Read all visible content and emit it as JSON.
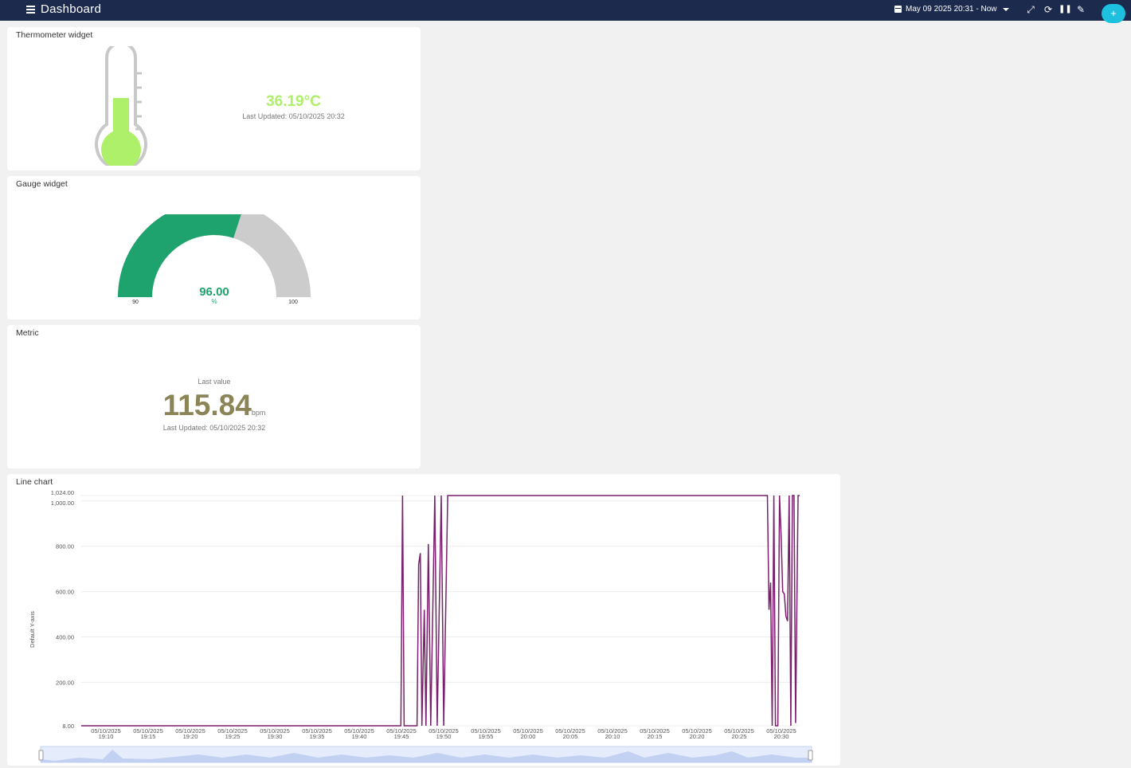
{
  "app": {
    "title": "Dashboard",
    "date_range": "May 09 2025 20:31 - Now",
    "add_label": "+"
  },
  "thermometer": {
    "title": "Thermometer widget",
    "value": "36.19°C",
    "last_updated": "Last Updated: 05/10/2025 20:32",
    "fill_fraction": 0.55,
    "color": "#aef06a"
  },
  "gauge": {
    "title": "Gauge widget",
    "value": "96.00",
    "unit": "%",
    "min": "90",
    "max": "100",
    "fraction": 0.6,
    "color": "#1ea36e"
  },
  "metric": {
    "title": "Metric",
    "caption": "Last value",
    "value": "115.84",
    "unit": "bpm",
    "last_updated": "Last Updated: 05/10/2025 20:32",
    "color": "#8a8456"
  },
  "linechart": {
    "title": "Line chart"
  },
  "chart_data": {
    "type": "line",
    "title": "",
    "xlabel": "",
    "ylabel": "Default Y-axis",
    "ylim": [
      8,
      1024
    ],
    "y_ticks": [
      "8.00",
      "200.00",
      "400.00",
      "600.00",
      "800.00",
      "1,000.00",
      "1,024.00"
    ],
    "x_ticks": [
      [
        "05/10/2025",
        "19:10"
      ],
      [
        "05/10/2025",
        "19:15"
      ],
      [
        "05/10/2025",
        "19:20"
      ],
      [
        "05/10/2025",
        "19:25"
      ],
      [
        "05/10/2025",
        "19:30"
      ],
      [
        "05/10/2025",
        "19:35"
      ],
      [
        "05/10/2025",
        "19:40"
      ],
      [
        "05/10/2025",
        "19:45"
      ],
      [
        "05/10/2025",
        "19:50"
      ],
      [
        "05/10/2025",
        "19:55"
      ],
      [
        "05/10/2025",
        "20:00"
      ],
      [
        "05/10/2025",
        "20:05"
      ],
      [
        "05/10/2025",
        "20:10"
      ],
      [
        "05/10/2025",
        "20:15"
      ],
      [
        "05/10/2025",
        "20:20"
      ],
      [
        "05/10/2025",
        "20:25"
      ],
      [
        "05/10/2025",
        "20:30"
      ]
    ],
    "color": "#7a1f6e",
    "series": [
      {
        "values": [
          [
            0,
            8
          ],
          [
            39.6,
            8
          ],
          [
            39.8,
            1024
          ],
          [
            40.0,
            8
          ],
          [
            41.6,
            8
          ],
          [
            41.8,
            720
          ],
          [
            42.0,
            770
          ],
          [
            42.2,
            8
          ],
          [
            42.5,
            520
          ],
          [
            42.7,
            8
          ],
          [
            43.0,
            810
          ],
          [
            43.3,
            8
          ],
          [
            43.8,
            1024
          ],
          [
            44.1,
            8
          ],
          [
            44.6,
            1024
          ],
          [
            44.9,
            8
          ],
          [
            45.4,
            1024
          ],
          [
            85.0,
            1024
          ],
          [
            85.2,
            520
          ],
          [
            85.4,
            640
          ],
          [
            85.6,
            8
          ],
          [
            85.8,
            1024
          ],
          [
            86.0,
            8
          ],
          [
            86.3,
            8
          ],
          [
            86.5,
            1024
          ],
          [
            86.7,
            850
          ],
          [
            86.9,
            600
          ],
          [
            87.1,
            590
          ],
          [
            87.3,
            490
          ],
          [
            87.5,
            470
          ],
          [
            87.7,
            1024
          ],
          [
            87.9,
            8
          ],
          [
            88.1,
            1024
          ],
          [
            88.3,
            1024
          ],
          [
            88.5,
            20
          ],
          [
            88.8,
            1024
          ],
          [
            89.0,
            1024
          ]
        ]
      }
    ]
  }
}
